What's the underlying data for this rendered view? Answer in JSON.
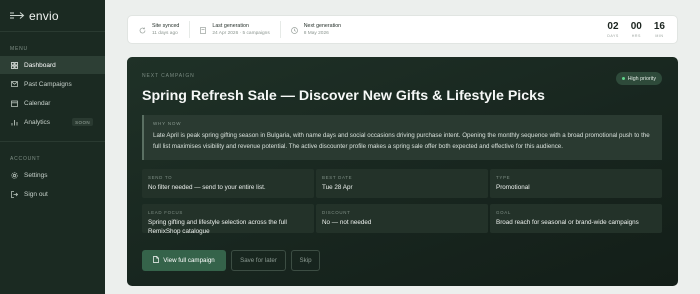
{
  "app": {
    "brand": "envio"
  },
  "sidebar": {
    "menu_heading": "MENU",
    "items": [
      {
        "label": "Dashboard",
        "icon": "grid-icon",
        "active": true
      },
      {
        "label": "Past Campaigns",
        "icon": "mail-icon"
      },
      {
        "label": "Calendar",
        "icon": "calendar-icon"
      },
      {
        "label": "Analytics",
        "icon": "bar-chart-icon",
        "badge": "SOON"
      }
    ],
    "account_heading": "ACCOUNT",
    "account_items": [
      {
        "label": "Settings",
        "icon": "gear-icon"
      },
      {
        "label": "Sign out",
        "icon": "sign-out-icon"
      }
    ]
  },
  "status": {
    "synced": {
      "title": "Site synced",
      "sub": "11 days ago",
      "icon": "sync-icon"
    },
    "last": {
      "title": "Last generation",
      "sub": "24 Apr 2026 · 5 campaigns",
      "icon": "document-icon"
    },
    "next": {
      "title": "Next generation",
      "sub": "8 May 2026",
      "icon": "clock-icon"
    },
    "countdown": {
      "days": "02",
      "days_label": "DAYS",
      "hours": "00",
      "hours_label": "HRS",
      "minutes": "16",
      "minutes_label": "MIN"
    }
  },
  "campaign": {
    "eyebrow": "NEXT CAMPAIGN",
    "priority": "High priority",
    "title": "Spring Refresh Sale — Discover New Gifts & Lifestyle Picks",
    "why_label": "WHY NOW",
    "why_text": "Late April is peak spring gifting season in Bulgaria, with name days and social occasions driving purchase intent. Opening the monthly sequence with a broad promotional push to the full list maximises visibility and revenue potential. The active discounter profile makes a spring sale offer both expected and effective for this audience.",
    "fields": [
      {
        "label": "SEND TO",
        "value": "No filter needed — send to your entire list."
      },
      {
        "label": "BEST DATE",
        "value": "Tue 28 Apr"
      },
      {
        "label": "TYPE",
        "value": "Promotional"
      },
      {
        "label": "LEAD FOCUS",
        "value": "Spring gifting and lifestyle selection across the full RemixShop catalogue"
      },
      {
        "label": "DISCOUNT",
        "value": "No — not needed"
      },
      {
        "label": "GOAL",
        "value": "Broad reach for seasonal or brand-wide campaigns"
      }
    ],
    "actions": {
      "primary": "View full campaign",
      "save": "Save for later",
      "skip": "Skip"
    }
  },
  "colors": {
    "sidebar_bg": "#1b2a22",
    "card_bg": "#1f3127",
    "accent": "#35634a",
    "priority_dot": "#5fd38a"
  }
}
